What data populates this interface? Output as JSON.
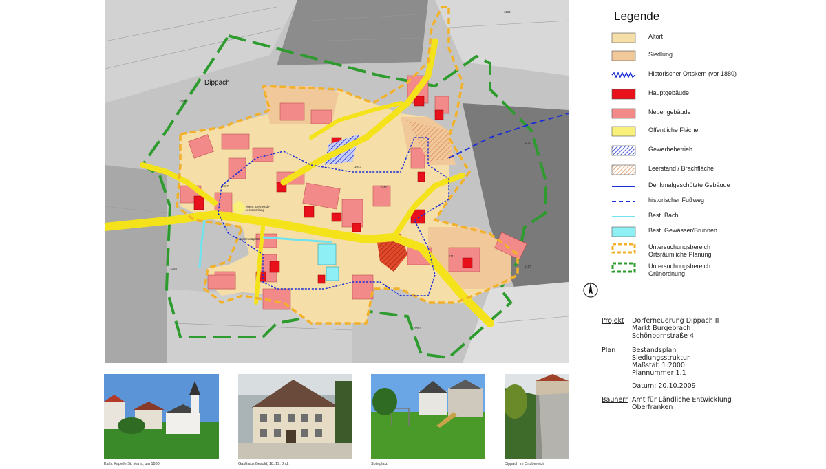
{
  "map": {
    "label_town": "Dippach",
    "labels": [
      {
        "id": "chapel",
        "text": "ehem. Gemeinde\nversammlung"
      },
      {
        "id": "stonepit",
        "text": "Steinmetzplatz"
      },
      {
        "id": "parcel1",
        "text": "1067"
      },
      {
        "id": "parcel2",
        "text": "1042"
      },
      {
        "id": "parcel3",
        "text": "1043"
      },
      {
        "id": "parcel4",
        "text": "1055"
      },
      {
        "id": "parcel5",
        "text": "1057"
      },
      {
        "id": "parcel6",
        "text": "1134"
      },
      {
        "id": "parcel7",
        "text": "1130"
      },
      {
        "id": "parcel8",
        "text": "1068"
      },
      {
        "id": "parcel9",
        "text": "1111"
      },
      {
        "id": "parcel10",
        "text": "1117"
      }
    ]
  },
  "legend": {
    "title": "Legende",
    "items": [
      {
        "id": "altort",
        "label": "Altort",
        "kind": "fill",
        "color": "#f5dea8"
      },
      {
        "id": "siedlung",
        "label": "Siedlung",
        "kind": "fill",
        "color": "#f1c89a"
      },
      {
        "id": "ortskern",
        "label": "Historischer Ortskern (vor 1880)",
        "kind": "zigzag",
        "color": "#1c2fd4"
      },
      {
        "id": "hauptgebaeude",
        "label": "Hauptgebäude",
        "kind": "fill",
        "color": "#e8101a"
      },
      {
        "id": "nebengebaeude",
        "label": "Nebengebäude",
        "kind": "fill",
        "color": "#f38a8a"
      },
      {
        "id": "oeffentlich",
        "label": "Öffentliche Flächen",
        "kind": "fill",
        "color": "#f8f07a"
      },
      {
        "id": "gewerbe",
        "label": "Gewerbebetrieb",
        "kind": "hatch",
        "color": "#4a5ad8"
      },
      {
        "id": "leerstand",
        "label": "Leerstand / Brachfläche",
        "kind": "hatch",
        "color": "#e8a67a"
      },
      {
        "id": "denkmal",
        "label": "Denkmalgeschützte Gebäude",
        "kind": "line",
        "color": "#1c2fd4"
      },
      {
        "id": "fussweg",
        "label": "historischer Fußweg",
        "kind": "dashline",
        "color": "#1c2fd4"
      },
      {
        "id": "bach",
        "label": "Best. Bach",
        "kind": "line",
        "color": "#6fe3ee"
      },
      {
        "id": "gewaesser",
        "label": "Best. Gewässer/Brunnen",
        "kind": "fill",
        "color": "#8ef0f4"
      },
      {
        "id": "ortsraeumlich",
        "label": "Untersuchungsbereich\nOrtsräumliche Planung",
        "kind": "dashbox",
        "color": "#f2b12a"
      },
      {
        "id": "gruenordnung",
        "label": "Untersuchungsbereich\nGrünordnung",
        "kind": "dashbox",
        "color": "#2e9b2e"
      }
    ]
  },
  "info": {
    "projekt_label": "Projekt",
    "projekt_value": "Dorferneuerung Dippach II\nMarkt Burgebrach\nSchönbornstraße 4",
    "plan_label": "Plan",
    "plan_value": "Bestandsplan\nSiedlungsstruktur\nMaßstab 1:2000\nPlannummer 1.1",
    "datum": "Datum: 20.10.2009",
    "bauherr_label": "Bauherr",
    "bauherr_value": "Amt für Ländliche Entwicklung\nOberfranken"
  },
  "photos": [
    {
      "caption": "Kath. Kapelle St. Maria, um 1880"
    },
    {
      "caption": "Gasthaus Besold, 18./19. Jhd."
    },
    {
      "caption": "Spielplatz"
    },
    {
      "caption": "Dippach im Ortsbereich"
    }
  ],
  "colors": {
    "gruen": "#2e9b2e",
    "orange": "#f2b12a",
    "road": "#f4e21a",
    "blue": "#1c2fd4"
  }
}
